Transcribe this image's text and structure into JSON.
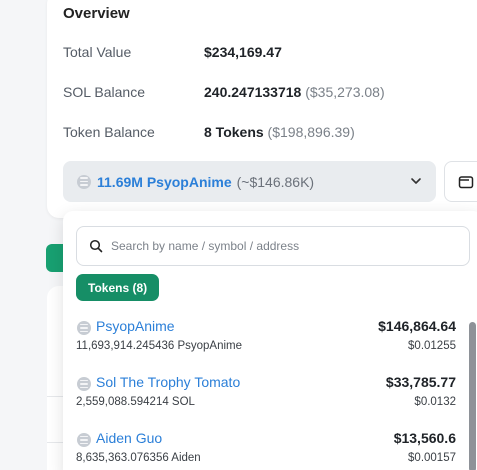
{
  "overview": {
    "title": "Overview",
    "total_value_label": "Total Value",
    "total_value": "$234,169.47",
    "sol_balance_label": "SOL Balance",
    "sol_balance": "240.247133718",
    "sol_balance_usd": "($35,273.08)",
    "token_balance_label": "Token Balance",
    "token_balance": "8 Tokens",
    "token_balance_usd": "($198,896.39)"
  },
  "selector": {
    "name": "11.69M PsyopAnime",
    "value": "(~$146.86K)",
    "icon": "coin-icon"
  },
  "dropdown": {
    "search_placeholder": "Search by name / symbol / address",
    "tokens_chip": "Tokens (8)",
    "items": [
      {
        "name": "PsyopAnime",
        "amount": "11,693,914.245436 PsyopAnime",
        "value": "$146,864.64",
        "price": "$0.01255"
      },
      {
        "name": "Sol The Trophy Tomato",
        "amount": "2,559,088.594214 SOL",
        "value": "$33,785.77",
        "price": "$0.0132"
      },
      {
        "name": "Aiden Guo",
        "amount": "8,635,363.076356 Aiden",
        "value": "$13,560.6",
        "price": "$0.00157"
      }
    ]
  },
  "colors": {
    "accent_blue": "#2b7fd8",
    "chip_green": "#168e66"
  }
}
